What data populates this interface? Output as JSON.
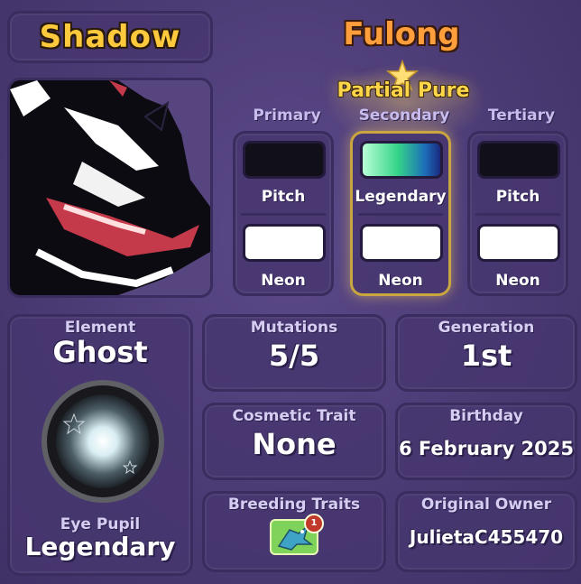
{
  "pet": {
    "name": "Shadow",
    "species": "Fulong",
    "purity": "Partial Pure"
  },
  "colors": {
    "columns": [
      {
        "heading": "Primary",
        "top_color": "#111018",
        "top_label": "Pitch",
        "bottom_color": "#ffffff",
        "bottom_label": "Neon"
      },
      {
        "heading": "Secondary",
        "top_color": "gradient-green-blue",
        "top_label": "Legendary",
        "bottom_color": "#ffffff",
        "bottom_label": "Neon"
      },
      {
        "heading": "Tertiary",
        "top_color": "#111018",
        "top_label": "Pitch",
        "bottom_color": "#ffffff",
        "bottom_label": "Neon"
      }
    ]
  },
  "element": {
    "title": "Element",
    "value": "Ghost",
    "eye_title": "Eye Pupil",
    "eye_value": "Legendary"
  },
  "stats": {
    "mutations": {
      "title": "Mutations",
      "value": "5/5"
    },
    "generation": {
      "title": "Generation",
      "value": "1st"
    },
    "cosmetic": {
      "title": "Cosmetic Trait",
      "value": "None"
    },
    "birthday": {
      "title": "Birthday",
      "value": "6 February 2025"
    },
    "breeding": {
      "title": "Breeding Traits",
      "badge": "1"
    },
    "owner": {
      "title": "Original Owner",
      "value": "JulietaC455470"
    }
  },
  "palette": {
    "accent_gold": "#ffc93d",
    "accent_orange": "#ff9e3a",
    "panel": "#46366e",
    "border": "#3a2c5e"
  }
}
